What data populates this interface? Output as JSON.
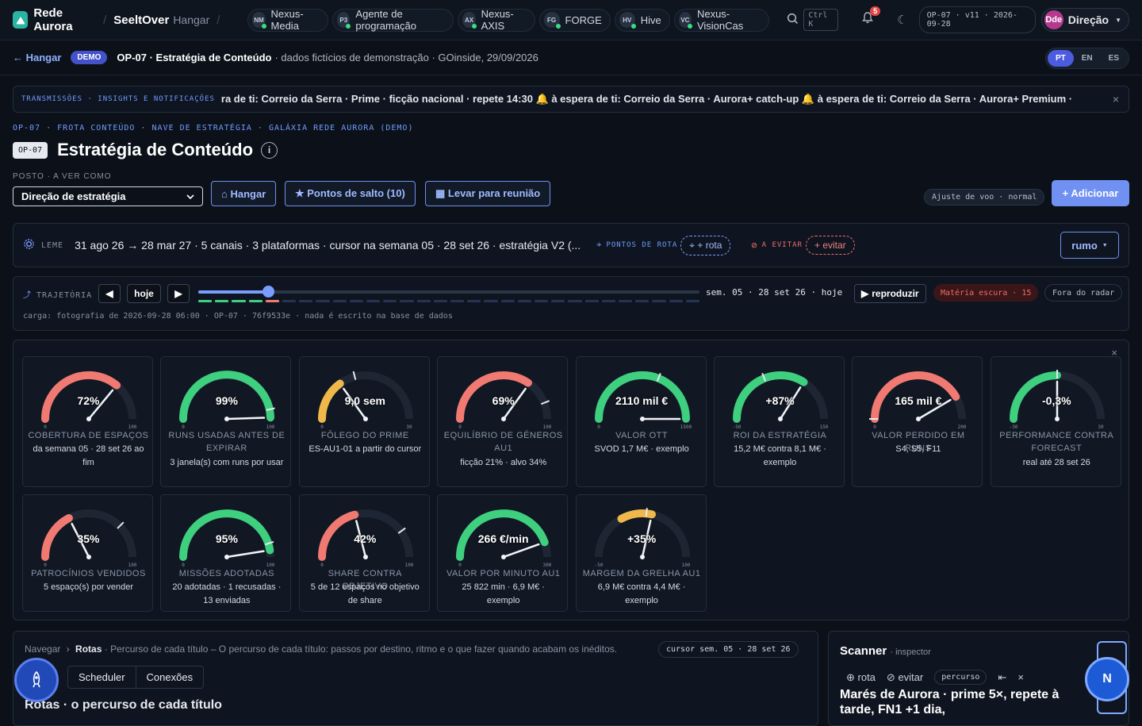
{
  "topbar": {
    "brand": "Rede Aurora",
    "sub_brand": "SeeltOver",
    "sub_hangar": "Hangar",
    "workspaces": [
      {
        "abbr": "NM",
        "label": "Nexus-Media"
      },
      {
        "abbr": "P3",
        "label": "Agente de programação"
      },
      {
        "abbr": "AX",
        "label": "Nexus-AXIS"
      },
      {
        "abbr": "FG",
        "label": "FORGE"
      },
      {
        "abbr": "HV",
        "label": "Hive"
      },
      {
        "abbr": "VC",
        "label": "Nexus-VisionCas"
      }
    ],
    "search_kbd": "Ctrl K",
    "notifications": "5",
    "version": "OP-07 · v11 · 2026-09-28",
    "user_initials": "Dde",
    "user_name": "Direção"
  },
  "subbar": {
    "back": "Hangar",
    "demo": "DEMO",
    "title": "OP-07 · Estratégia de Conteúdo",
    "subtitle": "· dados fictícios de demonstração · GOinside, 29/09/2026",
    "langs": [
      "PT",
      "EN",
      "ES"
    ]
  },
  "ticker": {
    "label": "TRANSMISSÕES · INSIGHTS E NOTIFICAÇÕES",
    "message": "ra de ti: Correio da Serra · Prime · ficção nacional · repete 14:30   🔔 à espera de ti: Correio da Serra · Aurora+ catch-up   🔔 à espera de ti: Correio da Serra · Aurora+ Premium ·"
  },
  "breadcrumb": "OP-07 · FROTA CONTEÚDO · NAVE DE ESTRATÉGIA · GALÁXIA REDE AURORA (DEMO)",
  "page": {
    "tag": "OP-07",
    "title": "Estratégia de Conteúdo",
    "post_label": "POSTO · A VER COMO",
    "post_value": "Direção de estratégia",
    "btn_hangar": "⌂ Hangar",
    "btn_pontos": "★ Pontos de salto (10)",
    "btn_reuniao": "▦ Levar para reunião",
    "ajuste": "Ajuste de voo · normal",
    "btn_add": "+ Adicionar"
  },
  "leme": {
    "label": "LEME",
    "text": "31 ago 26 → 28 mar 27  ·  5 canais · 3 plataformas  ·  cursor na semana 05 · 28 set 26  ·  estratégia V2 (...",
    "pontos_label": "PONTOS DE ROTA",
    "pontos_btn": "+ rota",
    "evitar_label": "A EVITAR",
    "evitar_btn": "+ evitar",
    "rumo": "rumo"
  },
  "trajetoria": {
    "label": "TRAJETÓRIA",
    "hoje": "hoje",
    "position": 0.14,
    "status": "sem. 05 · 28 set 26 · hoje",
    "reproduzir": "reproduzir",
    "materia": "Matéria escura · 15",
    "radar": "Fora do radar",
    "carga": "carga: fotografia de 2026-09-28 06:00 · OP-07 · 76f9533e · nada é escrito na base de dados"
  },
  "gauges": [
    {
      "value": "72%",
      "name": "COBERTURA DE ESPAÇOS",
      "sub": "da semana 05 · 28 set 26 ao fim",
      "level": 0.72,
      "color": "#f07a72",
      "min": "0",
      "max": "100",
      "needle": 0.72,
      "target": null
    },
    {
      "value": "99%",
      "name": "RUNS USADAS ANTES DE EXPIRAR",
      "sub": "3 janela(s) com runs por usar",
      "level": 0.99,
      "color": "#3ecf7f",
      "min": "0",
      "max": "100",
      "needle": 0.99,
      "target": 0.93
    },
    {
      "value": "9,0 sem",
      "name": "FÔLEGO DO PRIME",
      "sub": "ES-AU1-01 a partir do cursor",
      "level": 0.3,
      "color": "#f0b84a",
      "min": "0",
      "max": "30",
      "needle": 0.3,
      "target": 0.42
    },
    {
      "value": "69%",
      "name": "EQUILÍBRIO DE GÉNEROS AU1",
      "sub": "ficção 21% · alvo 34%",
      "level": 0.69,
      "color": "#f07a72",
      "min": "0",
      "max": "100",
      "needle": 0.7,
      "target": 0.88
    },
    {
      "value": "2110 mil €",
      "name": "VALOR OTT",
      "sub": "SVOD 1,7 M€ · exemplo",
      "level": 1.0,
      "color": "#3ecf7f",
      "min": "0",
      "max": "1500",
      "needle": 1.0,
      "target": 0.62
    },
    {
      "value": "+87%",
      "name": "ROI DA ESTRATÉGIA",
      "sub": "15,2 M€ contra 8,1 M€ · exemplo",
      "level": 0.68,
      "color": "#3ecf7f",
      "min": "-50",
      "max": "150",
      "needle": 0.68,
      "target": 0.38
    },
    {
      "value": "165 mil €",
      "name": "VALOR PERDIDO EM RUNS",
      "sub": "S4, S5, F11",
      "level": 0.83,
      "color": "#f07a72",
      "min": "0",
      "max": "200",
      "needle": 0.83,
      "target": 0.0
    },
    {
      "value": "-0,3%",
      "name": "PERFORMANCE CONTRA FORECAST",
      "sub": "real até 28 set 26",
      "level": 0.5,
      "color": "#3ecf7f",
      "min": "-30",
      "max": "30",
      "needle": 0.5,
      "target": 0.5
    },
    {
      "value": "35%",
      "name": "PATROCÍNIOS VENDIDOS",
      "sub": "5 espaço(s) por vender",
      "level": 0.35,
      "color": "#f07a72",
      "min": "0",
      "max": "100",
      "needle": 0.35,
      "target": 0.75
    },
    {
      "value": "95%",
      "name": "MISSÕES ADOTADAS",
      "sub": "20 adotadas · 1 recusadas · 13 enviadas",
      "level": 0.95,
      "color": "#3ecf7f",
      "min": "0",
      "max": "100",
      "needle": 0.95,
      "target": 0.9
    },
    {
      "value": "42%",
      "name": "SHARE CONTRA OBJETIVO",
      "sub": "5 de 12 espaços no objetivo de share",
      "level": 0.42,
      "color": "#f07a72",
      "min": "0",
      "max": "100",
      "needle": 0.42,
      "target": 0.8
    },
    {
      "value": "266 €/min",
      "name": "VALOR POR MINUTO AU1",
      "sub": "25 822 min · 6,9 M€ · exemplo",
      "level": 0.89,
      "color": "#3ecf7f",
      "min": "0",
      "max": "300",
      "needle": 0.89,
      "target": null
    },
    {
      "value": "+35%",
      "name": "MARGEM DA GRELHA AU1",
      "sub": "6,9 M€ contra 4,4 M€ · exemplo",
      "level": 0.57,
      "color": "#f0b84a",
      "level_start": 0.34,
      "min": "-50",
      "max": "100",
      "needle": 0.57,
      "target": 0.53
    }
  ],
  "nav": {
    "crumb_root": "Navegar",
    "crumb_current": "Rotas",
    "crumb_desc": "· Percurso de cada título – O percurso de cada título: passos por destino, ritmo e o que fazer quando acabam os inéditos.",
    "cursor": "cursor sem. 05 · 28 set 26",
    "tabs": [
      "Scheduler",
      "Conexões"
    ],
    "heading": "Rotas · o percurso de cada título"
  },
  "scanner": {
    "title": "Scanner",
    "sub": "· inspector",
    "rota": "rota",
    "evitar": "evitar",
    "chip": "percurso",
    "headline": "Marés de Aurora · prime 5×, repete à tarde, FN1 +1 dia,",
    "badge": "N"
  }
}
